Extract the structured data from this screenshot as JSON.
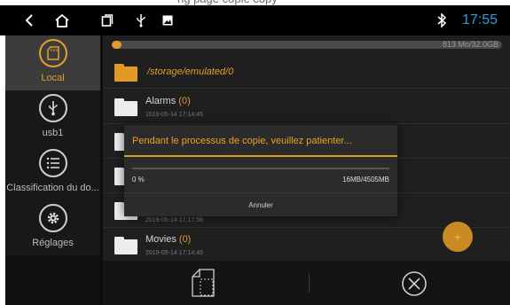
{
  "statusbar": {
    "time": "17:55",
    "icons": [
      "back-icon",
      "home-icon",
      "recent-apps-icon",
      "usb-icon",
      "image-icon",
      "bluetooth-icon"
    ]
  },
  "sidebar": {
    "items": [
      {
        "label": "Local",
        "icon": "sd-card-icon",
        "active": true
      },
      {
        "label": "usb1",
        "icon": "usb-icon",
        "active": false
      },
      {
        "label": "Classification du do...",
        "icon": "list-icon",
        "active": false
      },
      {
        "label": "Réglages",
        "icon": "gear-icon",
        "active": false
      }
    ]
  },
  "storage": {
    "text": "813 Mo/32.0GB",
    "used_fraction": 0.025
  },
  "path": "/storage/emulated/0",
  "files": [
    {
      "name": "Alarms",
      "count": "(0)",
      "date": "2019-05-14 17:14:45"
    },
    {
      "name": "",
      "count": "",
      "date": ""
    },
    {
      "name": "",
      "count": "",
      "date": ""
    },
    {
      "name": "",
      "count": "",
      "date": "2019-05-14 17:17:56"
    },
    {
      "name": "Movies",
      "count": "(0)",
      "date": "2019-05-14 17:14:45"
    }
  ],
  "dialog": {
    "title": "Pendant le processus de copie, veuillez patienter...",
    "percent": "0 %",
    "progress": 0.0,
    "size": "16MB/4505MB",
    "cancel_label": "Annuler"
  },
  "fab_label": "+",
  "colors": {
    "accent": "#e09a25",
    "time": "#2f9bdf",
    "background": "#1f1f1f"
  }
}
